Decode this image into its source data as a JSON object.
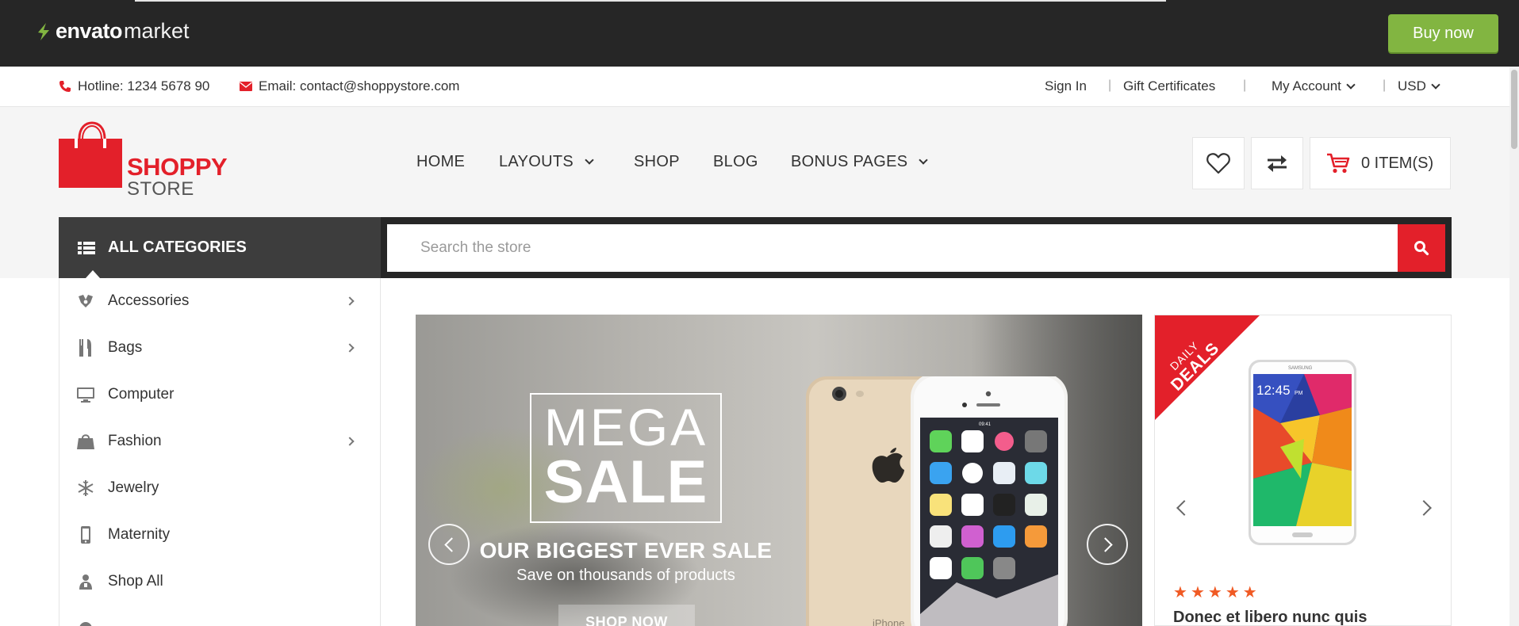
{
  "envato": {
    "logo_bold": "envato",
    "logo_light": "market",
    "buy_now": "Buy now"
  },
  "topbar": {
    "hotline": "Hotline: 1234 5678 90",
    "email": "Email: contact@shoppystore.com",
    "sign_in": "Sign In",
    "gift": "Gift Certificates",
    "account": "My Account",
    "currency": "USD",
    "separator": "|"
  },
  "logo": {
    "line1": "SHOPPY",
    "line2": "STORE"
  },
  "nav": [
    {
      "label": "HOME"
    },
    {
      "label": "LAYOUTS"
    },
    {
      "label": "SHOP"
    },
    {
      "label": "BLOG"
    },
    {
      "label": "BONUS PAGES"
    }
  ],
  "cart": {
    "label": "0 ITEM(S)"
  },
  "categories_title": "ALL CATEGORIES",
  "search": {
    "placeholder": "Search the store"
  },
  "categories": [
    {
      "label": "Accessories",
      "icon": "accessories-icon",
      "has_sub": true
    },
    {
      "label": "Bags",
      "icon": "bags-icon",
      "has_sub": true
    },
    {
      "label": "Computer",
      "icon": "computer-icon",
      "has_sub": false
    },
    {
      "label": "Fashion",
      "icon": "fashion-icon",
      "has_sub": true
    },
    {
      "label": "Jewelry",
      "icon": "jewelry-icon",
      "has_sub": false
    },
    {
      "label": "Maternity",
      "icon": "maternity-icon",
      "has_sub": false
    },
    {
      "label": "Shop All",
      "icon": "shop-all-icon",
      "has_sub": false
    }
  ],
  "banner": {
    "mega": "MEGA",
    "sale": "SALE",
    "headline": "OUR BIGGEST EVER SALE",
    "sub": "Save on thousands of products",
    "button": "SHOP NOW",
    "phone_label": "iPhone",
    "time": "09:41"
  },
  "deals": {
    "ribbon_small": "DAILY",
    "ribbon_big": "DEALS",
    "tablet_brand": "SAMSUNG",
    "tablet_time": "12:45",
    "tablet_ampm": "PM",
    "rating": 5,
    "rating_max": 5,
    "title": "Donec et libero nunc quis"
  },
  "colors": {
    "brand_red": "#e3202a",
    "envato_green": "#82b541",
    "dark": "#262626"
  }
}
